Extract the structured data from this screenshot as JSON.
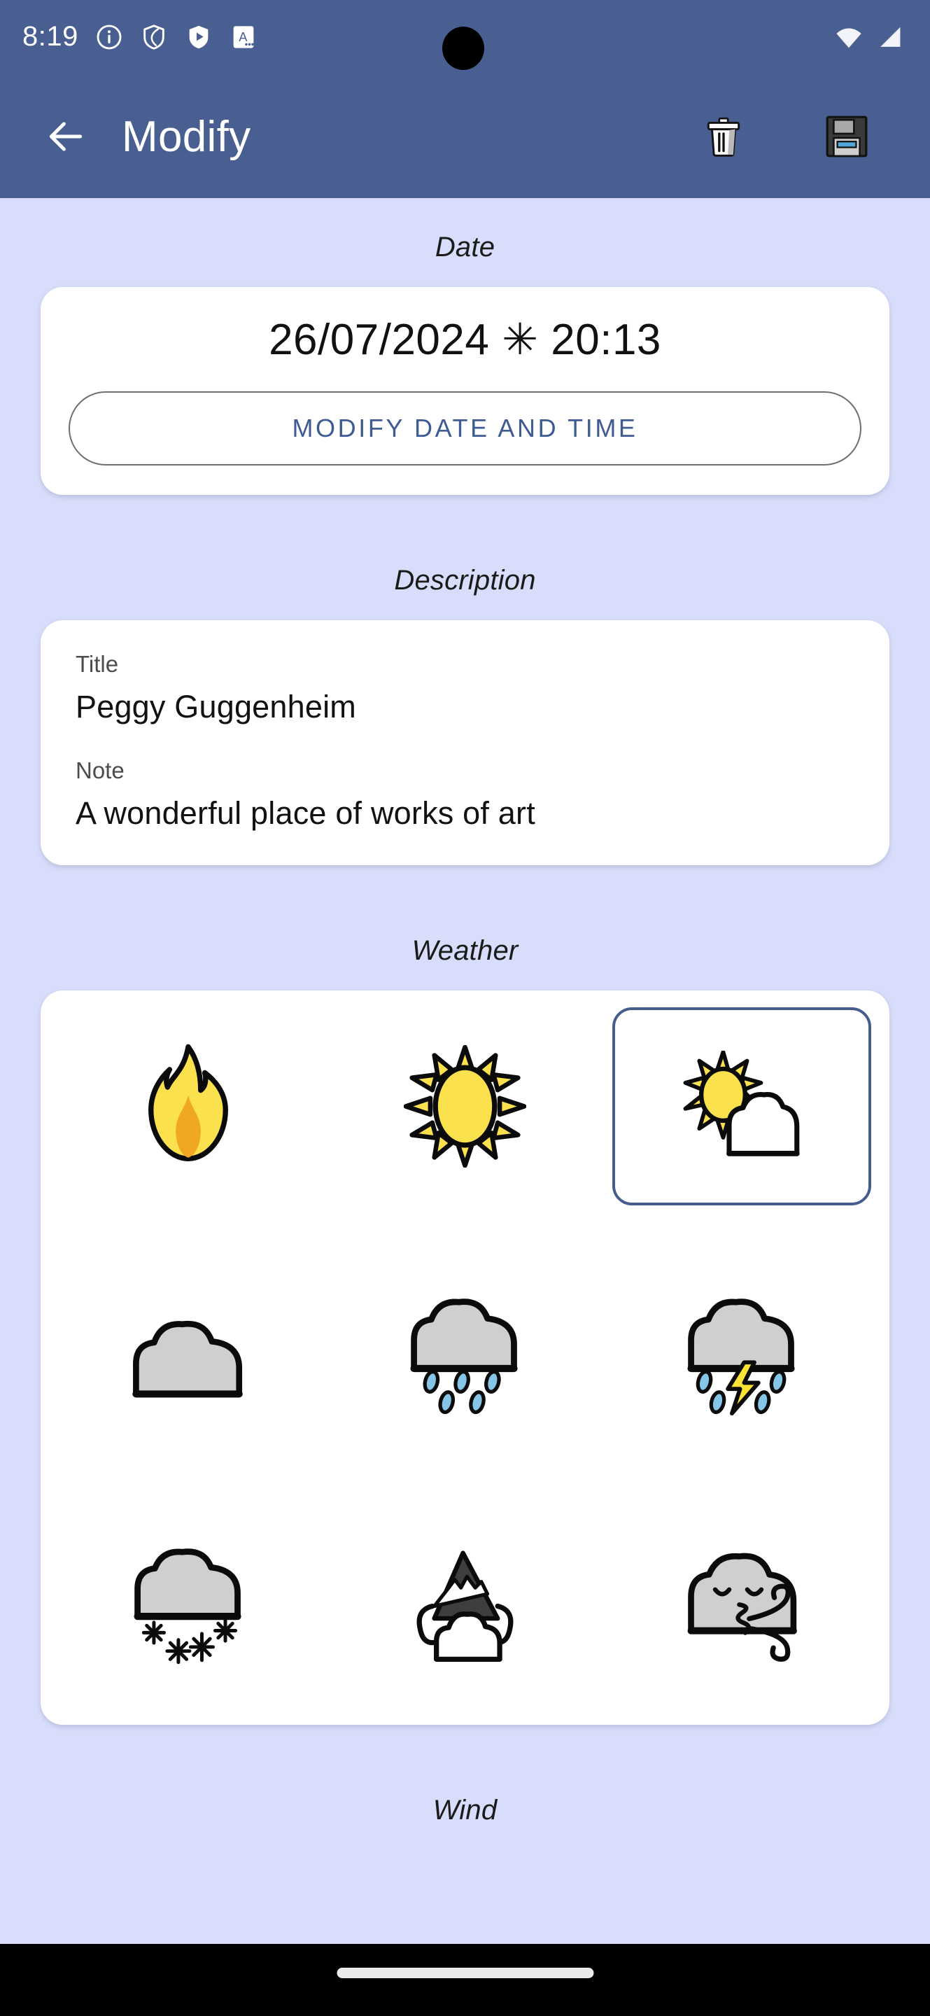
{
  "status_bar": {
    "time": "8:19",
    "left_icons": [
      "info-circle-icon",
      "shield-outline-icon",
      "shield-play-icon",
      "letter-a-badge-icon"
    ],
    "right_icons": [
      "wifi-icon",
      "cellular-signal-icon"
    ]
  },
  "app_bar": {
    "title": "Modify",
    "back_icon": "arrow-left-icon",
    "delete_icon": "trash-icon",
    "save_icon": "floppy-disk-icon",
    "background_color": "#4A5F91"
  },
  "sections": {
    "date_label": "Date",
    "description_label": "Description",
    "weather_label": "Weather",
    "wind_label": "Wind"
  },
  "date_card": {
    "value": "26/07/2024 ✳ 20:13",
    "button_label": "MODIFY DATE AND TIME"
  },
  "description_card": {
    "title_label": "Title",
    "title_value": "Peggy Guggenheim",
    "note_label": "Note",
    "note_value": "A wonderful place of works of art"
  },
  "weather_card": {
    "selected_index": 2,
    "options": [
      {
        "id": "hot",
        "icon": "fire-flame-icon",
        "selected": false
      },
      {
        "id": "sunny",
        "icon": "sun-icon",
        "selected": false
      },
      {
        "id": "partly-cloudy",
        "icon": "sun-behind-cloud-icon",
        "selected": true
      },
      {
        "id": "cloudy",
        "icon": "cloud-icon",
        "selected": false
      },
      {
        "id": "rainy",
        "icon": "cloud-with-rain-icon",
        "selected": false
      },
      {
        "id": "stormy",
        "icon": "cloud-with-lightning-and-rain-icon",
        "selected": false
      },
      {
        "id": "snowy",
        "icon": "cloud-with-snow-icon",
        "selected": false
      },
      {
        "id": "foggy",
        "icon": "mountain-in-fog-icon",
        "selected": false
      },
      {
        "id": "windy",
        "icon": "wind-blowing-face-icon",
        "selected": false
      }
    ]
  },
  "theme": {
    "page_background": "#D7DDFA",
    "card_background": "#FFFFFF",
    "accent": "#3F5B94",
    "selected_border": "#465C8F"
  }
}
